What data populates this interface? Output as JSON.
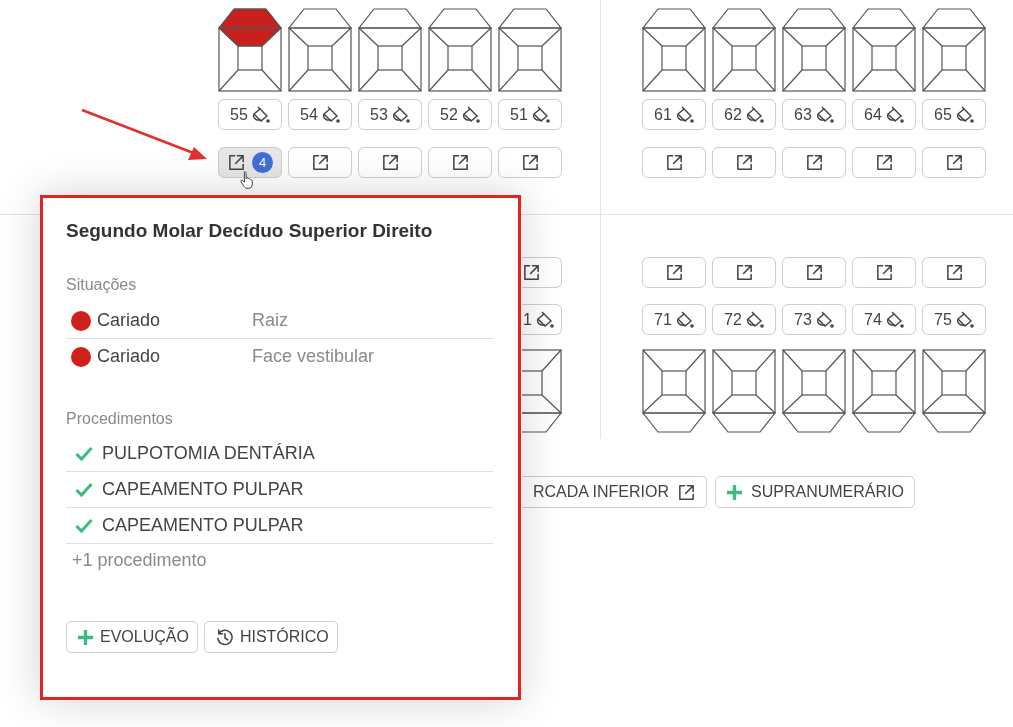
{
  "upper_left": [
    {
      "number": "55",
      "caries": true,
      "selected": true,
      "badge": "4"
    },
    {
      "number": "54",
      "caries": false,
      "selected": false
    },
    {
      "number": "53",
      "caries": false,
      "selected": false
    },
    {
      "number": "52",
      "caries": false,
      "selected": false
    },
    {
      "number": "51",
      "caries": false,
      "selected": false
    }
  ],
  "upper_right": [
    {
      "number": "61",
      "caries": false,
      "selected": false
    },
    {
      "number": "62",
      "caries": false,
      "selected": false
    },
    {
      "number": "63",
      "caries": false,
      "selected": false
    },
    {
      "number": "64",
      "caries": false,
      "selected": false
    },
    {
      "number": "65",
      "caries": false,
      "selected": false
    }
  ],
  "lower_left": [
    {
      "number": "1"
    }
  ],
  "lower_right": [
    {
      "number": "71",
      "caries": false,
      "selected": false
    },
    {
      "number": "72",
      "caries": false,
      "selected": false
    },
    {
      "number": "73",
      "caries": false,
      "selected": false
    },
    {
      "number": "74",
      "caries": false,
      "selected": false
    },
    {
      "number": "75",
      "caries": false,
      "selected": false
    }
  ],
  "arch_buttons": [
    {
      "label": "RCADA INFERIOR",
      "kind": "open"
    },
    {
      "label": "SUPRANUMERÁRIO",
      "kind": "add"
    }
  ],
  "popover": {
    "title": "Segundo Molar Decíduo Superior Direito",
    "situations_heading": "Situações",
    "situations": [
      {
        "name": "Cariado",
        "location": "Raiz",
        "color": "#d0201c"
      },
      {
        "name": "Cariado",
        "location": "Face vestibular",
        "color": "#d0201c"
      }
    ],
    "procedures_heading": "Procedimentos",
    "procedures": [
      {
        "name": "PULPOTOMIA DENTÁRIA",
        "done": true
      },
      {
        "name": "CAPEAMENTO PULPAR",
        "done": true
      },
      {
        "name": "CAPEAMENTO PULPAR",
        "done": true
      }
    ],
    "more": "+1 procedimento",
    "buttons": [
      {
        "label": "EVOLUÇÃO",
        "kind": "add"
      },
      {
        "label": "HISTÓRICO",
        "kind": "history"
      }
    ]
  }
}
